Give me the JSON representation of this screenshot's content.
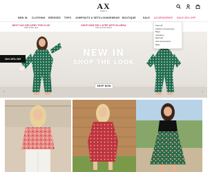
{
  "header": {
    "logo": "AX",
    "logo_sub": "PARIS",
    "icons": [
      "search-icon",
      "user-icon",
      "bag-icon"
    ]
  },
  "nav": {
    "items": [
      "NEW IN",
      "CLOTHING",
      "DRESSES",
      "TOPS",
      "JUMPSUITS & SETS",
      "LOUNGEWEAR",
      "BOUTIQUE",
      "SALE",
      "ACCESSORIES",
      "SALE 40% OFF"
    ]
  },
  "promos": [
    {
      "title": "NEXT DAY DELIVERY FOR £4.99",
      "sub": "Order before 4pm"
    },
    {
      "title": "SHOP NOW PAY LATER WITH KLARNA",
      "sub": "Find out more below"
    }
  ],
  "dropdown": {
    "items": [
      "View all",
      "Fashion Accessories",
      "Bags",
      "Jewellery",
      "Earrings",
      "Hair Accessories",
      "Belts"
    ]
  },
  "hero": {
    "title": "NEW IN",
    "subtitle": "SHOP THE LOOK",
    "cta": "SHOP NOW",
    "prev": "‹",
    "next": "›"
  },
  "discount_tab": "Get 10% Off",
  "colors": {
    "accent": "#e0457b",
    "hero_text": "#ffffff",
    "dress_green": "#1f6b4e",
    "dress_red": "#c8323f"
  }
}
